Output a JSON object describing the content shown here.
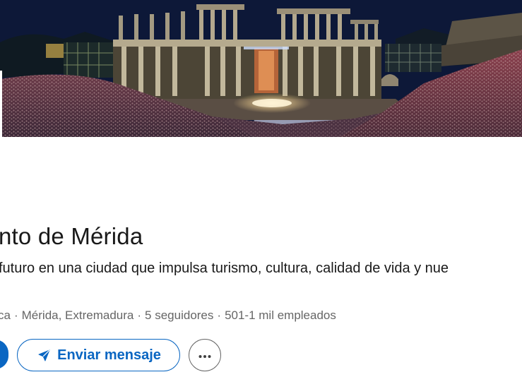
{
  "banner": {
    "icon": "theatre-photo",
    "colors": {
      "sky": "#0d1838",
      "stone": "#9c9178",
      "stage_light": "#f2e6c4",
      "crowd": "#7a3a44"
    }
  },
  "profile": {
    "name": "nto de Mérida",
    "tagline": "futuro en una ciudad que impulsa turismo, cultura, calidad de vida y nue",
    "meta": {
      "category": "ca",
      "location": "Mérida, Extremadura",
      "followers": "5 seguidores",
      "employees": "501-1 mil empleados"
    }
  },
  "actions": {
    "message_label": "Enviar mensaje",
    "message_icon": "send-icon",
    "more_icon": "more-icon"
  },
  "colors": {
    "accent": "#0a66c2",
    "text_primary": "#191919",
    "text_secondary": "#666666"
  }
}
